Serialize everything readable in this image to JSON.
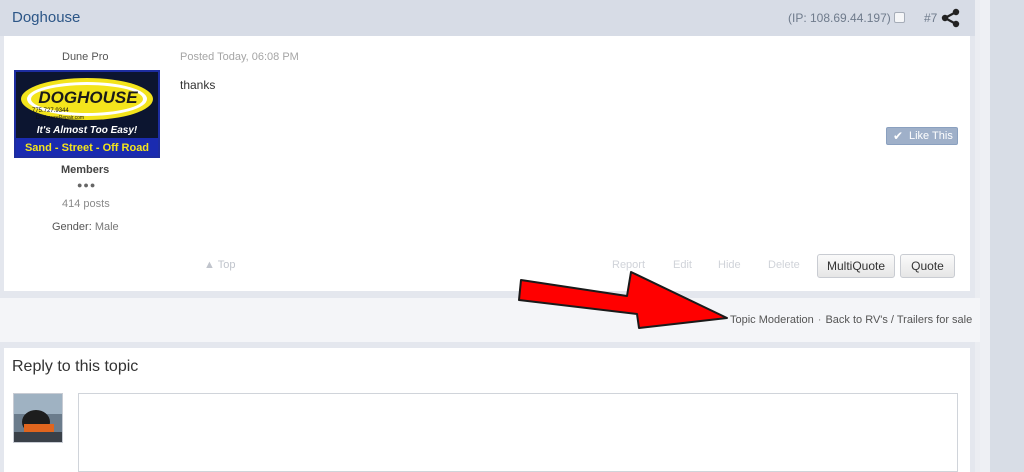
{
  "post": {
    "author": "Doghouse",
    "ip_label": "(IP: 108.69.44.197)",
    "post_number": "#7",
    "rank_title": "Dune Pro",
    "avatar": {
      "brand": "DOGHOUSE",
      "phone": "775.727.9344",
      "site": "DoghouseRepair.com",
      "tagline": "It's Almost Too Easy!",
      "banner": "Sand - Street - Off Road"
    },
    "group": "Members",
    "pips": "●●●",
    "post_count": "414 posts",
    "gender_label": "Gender:",
    "gender_value": "Male",
    "posted": "Posted Today, 06:08 PM",
    "content": "thanks",
    "like_label": "Like This"
  },
  "controls": {
    "top": "▲ Top",
    "report": "Report",
    "edit": "Edit",
    "hide": "Hide",
    "delete": "Delete",
    "multiquote": "MultiQuote",
    "quote": "Quote"
  },
  "moderation": {
    "topic_moderation": "Topic Moderation",
    "separator": "·",
    "back_link": "Back to RV's / Trailers for sale"
  },
  "reply": {
    "title": "Reply to this topic"
  },
  "colors": {
    "header_bg": "#d7dce6",
    "author_link": "#2c5687",
    "arrow": "#ff0000"
  }
}
